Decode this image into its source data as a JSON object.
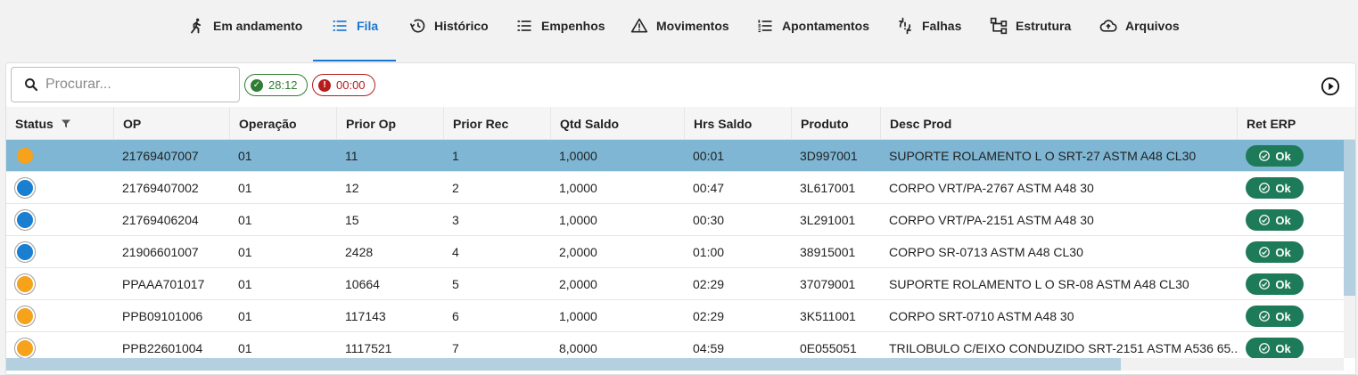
{
  "tabs": [
    {
      "label": "Em andamento",
      "icon": "running-person-icon"
    },
    {
      "label": "Fila",
      "icon": "list-icon",
      "active": true
    },
    {
      "label": "Histórico",
      "icon": "history-icon"
    },
    {
      "label": "Empenhos",
      "icon": "list-icon"
    },
    {
      "label": "Movimentos",
      "icon": "warning-icon"
    },
    {
      "label": "Apontamentos",
      "icon": "numbered-list-icon"
    },
    {
      "label": "Falhas",
      "icon": "sync-problem-icon"
    },
    {
      "label": "Estrutura",
      "icon": "tree-structure-icon"
    },
    {
      "label": "Arquivos",
      "icon": "cloud-upload-icon"
    }
  ],
  "toolbar": {
    "search_placeholder": "Procurar...",
    "chip_ok": "28:12",
    "chip_fail": "00:00"
  },
  "colors": {
    "accent": "#1976d2",
    "selected_row": "#7eb6d3",
    "ok_badge": "#1e7b5a",
    "status_orange": "#f7a21b",
    "status_blue": "#1a7fd0"
  },
  "table": {
    "headers": {
      "status": "Status",
      "op": "OP",
      "operacao": "Operação",
      "prior_op": "Prior Op",
      "prior_rec": "Prior Rec",
      "qtd_saldo": "Qtd Saldo",
      "hrs_saldo": "Hrs Saldo",
      "produto": "Produto",
      "desc_prod": "Desc Prod",
      "ret_erp": "Ret ERP"
    },
    "rows": [
      {
        "status": "orange",
        "op": "21769407007",
        "operacao": "01",
        "prior_op": "11",
        "prior_rec": "1",
        "qtd_saldo": "1,0000",
        "hrs_saldo": "00:01",
        "produto": "3D997001",
        "desc_prod": "SUPORTE ROLAMENTO L O SRT-27 ASTM A48 CL30",
        "ret_erp": "Ok"
      },
      {
        "status": "blue",
        "op": "21769407002",
        "operacao": "01",
        "prior_op": "12",
        "prior_rec": "2",
        "qtd_saldo": "1,0000",
        "hrs_saldo": "00:47",
        "produto": "3L617001",
        "desc_prod": "CORPO VRT/PA-2767 ASTM A48 30",
        "ret_erp": "Ok"
      },
      {
        "status": "blue",
        "op": "21769406204",
        "operacao": "01",
        "prior_op": "15",
        "prior_rec": "3",
        "qtd_saldo": "1,0000",
        "hrs_saldo": "00:30",
        "produto": "3L291001",
        "desc_prod": "CORPO VRT/PA-2151 ASTM A48 30",
        "ret_erp": "Ok"
      },
      {
        "status": "blue",
        "op": "21906601007",
        "operacao": "01",
        "prior_op": "2428",
        "prior_rec": "4",
        "qtd_saldo": "2,0000",
        "hrs_saldo": "01:00",
        "produto": "38915001",
        "desc_prod": "CORPO SR-0713 ASTM A48 CL30",
        "ret_erp": "Ok"
      },
      {
        "status": "orange",
        "op": "PPAAA701017",
        "operacao": "01",
        "prior_op": "10664",
        "prior_rec": "5",
        "qtd_saldo": "2,0000",
        "hrs_saldo": "02:29",
        "produto": "37079001",
        "desc_prod": "SUPORTE ROLAMENTO L O SR-08 ASTM A48 CL30",
        "ret_erp": "Ok"
      },
      {
        "status": "orange",
        "op": "PPB09101006",
        "operacao": "01",
        "prior_op": "117143",
        "prior_rec": "6",
        "qtd_saldo": "1,0000",
        "hrs_saldo": "02:29",
        "produto": "3K511001",
        "desc_prod": "CORPO SRT-0710 ASTM A48 30",
        "ret_erp": "Ok"
      },
      {
        "status": "orange",
        "op": "PPB22601004",
        "operacao": "01",
        "prior_op": "1117521",
        "prior_rec": "7",
        "qtd_saldo": "8,0000",
        "hrs_saldo": "04:59",
        "produto": "0E055051",
        "desc_prod": "TRILOBULO C/EIXO CONDUZIDO SRT-2151 ASTM A536 65...",
        "ret_erp": "Ok"
      }
    ]
  }
}
